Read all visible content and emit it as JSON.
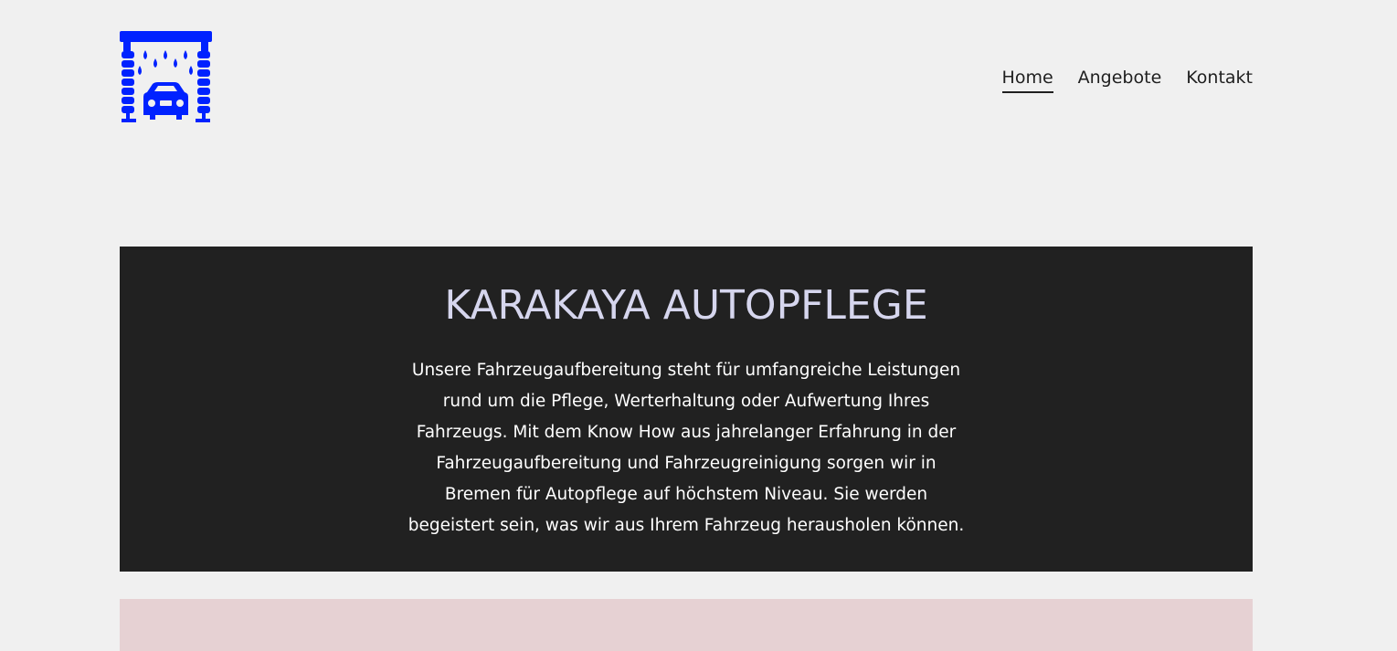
{
  "brand": {
    "accent": "#0022ff",
    "logo_icon": "car-wash-icon"
  },
  "nav": {
    "items": [
      {
        "label": "Home"
      },
      {
        "label": "Angebote"
      },
      {
        "label": "Kontakt"
      }
    ]
  },
  "hero": {
    "title": "KARAKAYA AUTOPFLEGE",
    "text": "Unsere Fahrzeugaufbereitung steht für umfangreiche Leistungen rund um die Pflege, Werterhaltung oder Aufwertung Ihres Fahrzeugs. Mit dem Know How aus jahrelanger Erfahrung in der Fahrzeugaufbereitung und Fahrzeugreinigung sorgen wir in Bremen für Autopflege auf höchstem Niveau. Sie werden begeistert sein, was wir aus Ihrem Fahrzeug herausholen können.",
    "background": "#212121"
  },
  "colors": {
    "page_background": "#f0f0f0",
    "band_background": "#e6d1d3"
  }
}
